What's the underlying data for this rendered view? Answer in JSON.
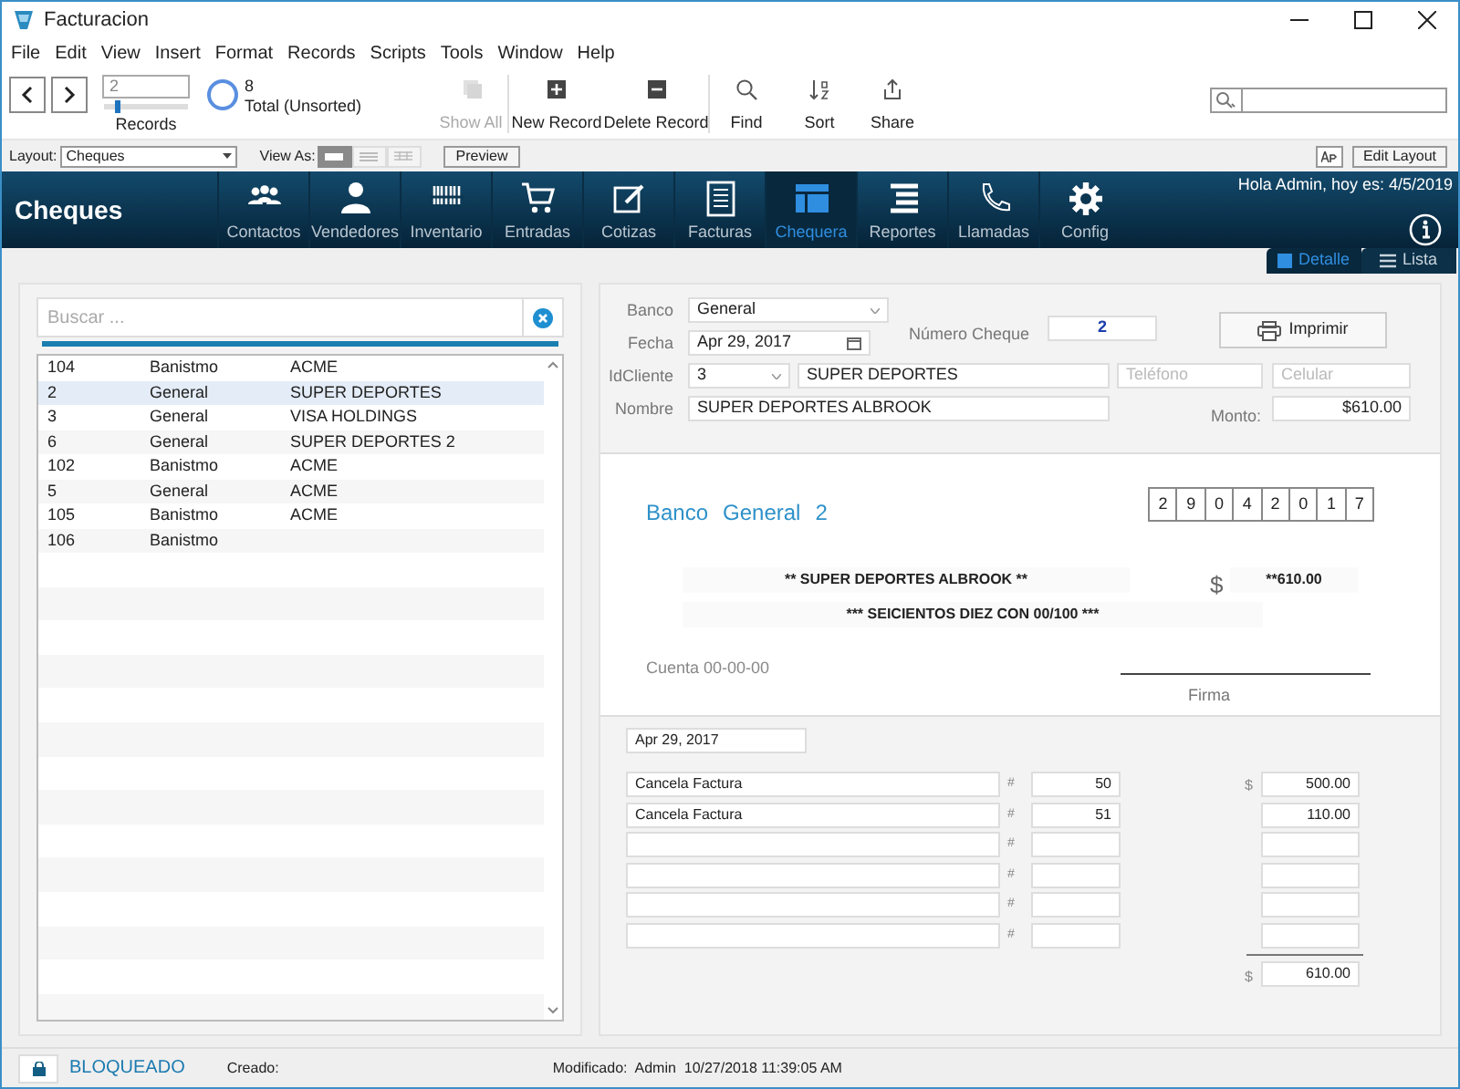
{
  "window": {
    "title": "Facturacion"
  },
  "menu": [
    "File",
    "Edit",
    "View",
    "Insert",
    "Format",
    "Records",
    "Scripts",
    "Tools",
    "Window",
    "Help"
  ],
  "toolbar": {
    "record": "2",
    "record_slider": {
      "level": 0.15
    },
    "records_label": "Records",
    "found": "8",
    "total": "Total (Unsorted)",
    "buttons": [
      {
        "kind": "showall",
        "label": "Show All",
        "disabled": true
      },
      {
        "kind": "new",
        "label": "New Record",
        "disabled": false
      },
      {
        "kind": "delete",
        "label": "Delete Record",
        "disabled": false
      },
      {
        "kind": "find",
        "label": "Find",
        "disabled": false
      },
      {
        "kind": "sort",
        "label": "Sort",
        "disabled": false
      },
      {
        "kind": "share",
        "label": "Share",
        "disabled": false
      }
    ]
  },
  "layout_bar": {
    "label": "Layout:",
    "layout": "Cheques",
    "view_as": "View As:",
    "views": [
      {
        "kind": "form",
        "selected": true
      },
      {
        "kind": "list",
        "selected": false
      },
      {
        "kind": "table",
        "selected": false
      }
    ],
    "preview": "Preview",
    "edit_layout": "Edit Layout"
  },
  "nav": {
    "title": "Cheques",
    "items": [
      {
        "kind": "people",
        "label": "Contactos",
        "selected": false
      },
      {
        "kind": "person",
        "label": "Vendedores",
        "selected": false
      },
      {
        "kind": "barcode",
        "label": "Inventario",
        "selected": false
      },
      {
        "kind": "cart",
        "label": "Entradas",
        "selected": false
      },
      {
        "kind": "edit",
        "label": "Cotizas",
        "selected": false
      },
      {
        "kind": "invoice",
        "label": "Facturas",
        "selected": false
      },
      {
        "kind": "layout",
        "label": "Chequera",
        "selected": true
      },
      {
        "kind": "lines",
        "label": "Reportes",
        "selected": false
      },
      {
        "kind": "phone",
        "label": "Llamadas",
        "selected": false
      },
      {
        "kind": "gear",
        "label": "Config",
        "selected": false
      }
    ],
    "greeting": "Hola Admin, hoy es: 4/5/2019"
  },
  "view_tabs": [
    {
      "kind": "detail",
      "label": "Detalle",
      "selected": true
    },
    {
      "kind": "list",
      "label": "Lista",
      "selected": false
    }
  ],
  "list": {
    "search": {
      "placeholder": "Buscar ..."
    },
    "rows": [
      {
        "cells": [
          "104",
          "Banistmo",
          "ACME"
        ],
        "selected": false
      },
      {
        "cells": [
          "2",
          "General",
          "SUPER DEPORTES"
        ],
        "selected": true
      },
      {
        "cells": [
          "3",
          "General",
          "VISA HOLDINGS"
        ],
        "selected": false
      },
      {
        "cells": [
          "6",
          "General",
          "SUPER DEPORTES 2"
        ],
        "selected": false
      },
      {
        "cells": [
          "102",
          "Banistmo",
          "ACME"
        ],
        "selected": false
      },
      {
        "cells": [
          "5",
          "General",
          "ACME"
        ],
        "selected": false
      },
      {
        "cells": [
          "105",
          "Banistmo",
          "ACME"
        ],
        "selected": false
      },
      {
        "cells": [
          "106",
          "Banistmo"
        ],
        "selected": false
      }
    ]
  },
  "form": {
    "banco": {
      "label": "Banco",
      "value": "General"
    },
    "fecha": {
      "label": "Fecha",
      "value": "Apr 29, 2017"
    },
    "numero": {
      "label": "Número Cheque",
      "value": "2"
    },
    "print": "Imprimir",
    "idcliente": {
      "label": "IdCliente",
      "value": "3"
    },
    "cliente": "SUPER DEPORTES",
    "telefono": {
      "placeholder": "Teléfono"
    },
    "celular": {
      "placeholder": "Celular"
    },
    "nombre": {
      "label": "Nombre",
      "value": "SUPER DEPORTES ALBROOK"
    },
    "monto": {
      "label": "Monto:",
      "value": "$610.00"
    }
  },
  "cheque": {
    "title": [
      "Banco",
      "General",
      "2"
    ],
    "date_digits": [
      "2",
      "9",
      "0",
      "4",
      "2",
      "0",
      "1",
      "7"
    ],
    "payee": "** SUPER DEPORTES ALBROOK **",
    "currency": "$",
    "amount": "**610.00",
    "words": "*** SEICIENTOS DIEZ CON 00/100 ***",
    "account": "Cuenta 00-00-00",
    "signature": "Firma"
  },
  "stub": {
    "date": "Apr 29, 2017",
    "lines": [
      {
        "description": "Cancela Factura",
        "hash": "#",
        "number": "50",
        "currency": "$",
        "amount": "500.00"
      },
      {
        "description": "Cancela Factura",
        "hash": "#",
        "number": "51",
        "amount": "110.00"
      },
      {
        "hash": "#"
      },
      {
        "hash": "#"
      },
      {
        "hash": "#"
      },
      {
        "hash": "#"
      }
    ],
    "total_currency": "$",
    "total": "610.00"
  },
  "status_bar": {
    "lock": "BLOQUEADO",
    "created": "Creado:",
    "modified": "Modificado:  Admin  10/27/2018 11:39:05 AM"
  }
}
